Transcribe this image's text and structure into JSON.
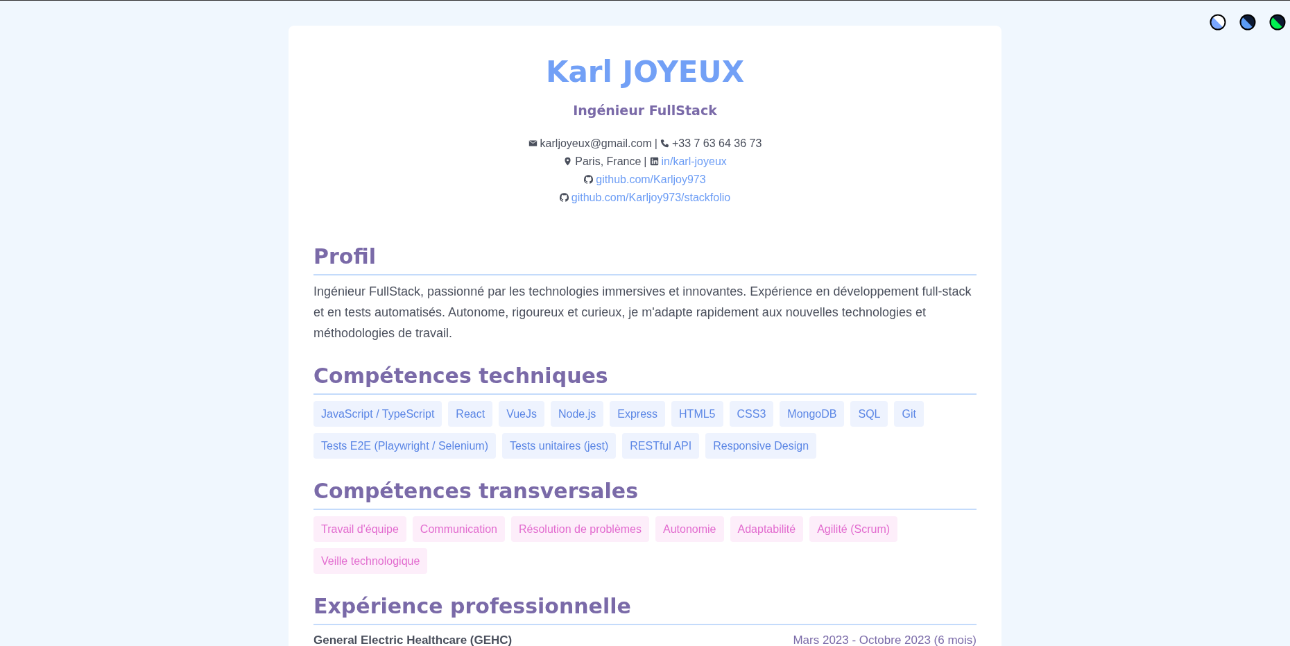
{
  "theme_buttons": [
    {
      "kind": "light"
    },
    {
      "kind": "dark"
    },
    {
      "kind": "green"
    }
  ],
  "header": {
    "name": "Karl JOYEUX",
    "title": "Ingénieur FullStack",
    "contacts": [
      {
        "separator": "|",
        "items": [
          {
            "kind": "mail",
            "text": "karljoyeux@gmail.com",
            "link": false
          },
          {
            "kind": "phone",
            "text": "+33 7 63 64 36 73",
            "link": false
          }
        ]
      },
      {
        "separator": "|",
        "items": [
          {
            "kind": "pin",
            "text": "Paris, France",
            "link": false
          },
          {
            "kind": "linkedin",
            "text": "in/karl-joyeux",
            "link": true
          }
        ]
      },
      {
        "items": [
          {
            "kind": "github",
            "text": "github.com/Karljoy973",
            "link": true
          }
        ]
      },
      {
        "items": [
          {
            "kind": "github",
            "text": "github.com/Karljoy973/stackfolio",
            "link": true
          }
        ]
      }
    ]
  },
  "profile": {
    "heading": "Profil",
    "text": "Ingénieur FullStack, passionné par les technologies immersives et innovantes. Expérience en développement full-stack et en tests automatisés. Autonome, rigoureux et curieux, je m'adapte rapidement aux nouvelles technologies et méthodologies de travail."
  },
  "skill_groups": [
    {
      "heading": "Compétences techniques",
      "kind": "technical",
      "tags": [
        "JavaScript / TypeScript",
        "React",
        "VueJs",
        "Node.js",
        "Express",
        "HTML5",
        "CSS3",
        "MongoDB",
        "SQL",
        "Git",
        "Tests E2E (Playwright / Selenium)",
        "Tests unitaires (jest)",
        "RESTful API",
        "Responsive Design"
      ]
    },
    {
      "heading": "Compétences transversales",
      "kind": "soft",
      "tags": [
        "Travail d'équipe",
        "Communication",
        "Résolution de problèmes",
        "Autonomie",
        "Adaptabilité",
        "Agilité (Scrum)",
        "Veille technologique"
      ]
    }
  ],
  "experience": {
    "heading": "Expérience professionnelle",
    "jobs": [
      {
        "company": "General Electric Healthcare (GEHC)",
        "dates": "Mars 2023 - Octobre 2023 (6 mois)"
      }
    ]
  }
}
